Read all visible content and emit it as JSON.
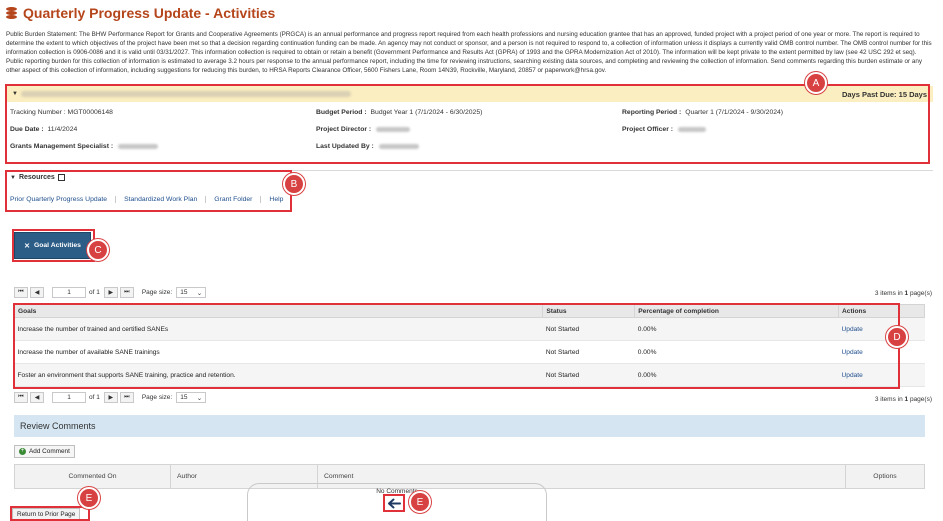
{
  "page": {
    "title": "Quarterly Progress Update - Activities",
    "burden_statement": "Public Burden Statement: The BHW Performance Report for Grants and Cooperative Agreements (PRGCA) is an annual performance and progress report required from each health professions and nursing education grantee that has an approved, funded project with a project period of one year or more. The report is required to determine the extent to which objectives of the project have been met so that a decision regarding continuation funding can be made. An agency may not conduct or sponsor, and a person is not required to respond to, a collection of information unless it displays a currently valid OMB control number. The OMB control number for this information collection is 0906-0086 and it is valid until 03/31/2027. This information collection is required to obtain or retain a benefit (Government Performance and Results Act (GPRA) of 1993 and the GPRA Modernization Act of 2010). The information will be kept private to the extent permitted by law (see 42 USC 292 et seq). Public reporting burden for this collection of information is estimated to average 3.2 hours per response to the annual performance report, including the time for reviewing instructions, searching existing data sources, and completing and reviewing the collection of information. Send comments regarding this burden estimate or any other aspect of this collection of information, including suggestions for reducing this burden, to HRSA Reports Clearance Officer, 5600 Fishers Lane, Room 14N39, Rockville, Maryland, 20857 or paperwork@hrsa.gov."
  },
  "info": {
    "days_past_due": "Days Past Due: 15 Days",
    "tracking_label": "Tracking Number :",
    "tracking_value": "MGT00006148",
    "budget_label": "Budget Period :",
    "budget_value": "Budget Year 1 (7/1/2024 - 6/30/2025)",
    "reporting_label": "Reporting Period :",
    "reporting_value": "Quarter 1 (7/1/2024 - 9/30/2024)",
    "due_label": "Due Date :",
    "due_value": "11/4/2024",
    "director_label": "Project Director :",
    "officer_label": "Project Officer :",
    "gms_label": "Grants Management Specialist :",
    "updated_label": "Last Updated By :"
  },
  "resources": {
    "title": "Resources",
    "links": [
      "Prior Quarterly Progress Update",
      "Standardized Work Plan",
      "Grant Folder",
      "Help"
    ]
  },
  "goal_button": "Goal Activities",
  "pager": {
    "page": "1",
    "of": "of 1",
    "page_size_label": "Page size:",
    "page_size": "15",
    "count_prefix": "3 items in ",
    "count_pages": "1",
    "count_suffix": " page(s)"
  },
  "goals_table": {
    "headers": [
      "Goals",
      "Status",
      "Percentage of completion",
      "Actions"
    ],
    "rows": [
      {
        "goal": "Increase the number of trained and certified SANEs",
        "status": "Not Started",
        "pct": "0.00%",
        "action": "Update"
      },
      {
        "goal": "Increase the number of available SANE trainings",
        "status": "Not Started",
        "pct": "0.00%",
        "action": "Update"
      },
      {
        "goal": "Foster an environment that supports SANE training, practice and retention.",
        "status": "Not Started",
        "pct": "0.00%",
        "action": "Update"
      }
    ]
  },
  "review": {
    "title": "Review Comments",
    "add_label": "Add Comment",
    "headers": [
      "Commented On",
      "Author",
      "Comment",
      "Options"
    ],
    "empty": "No Comments"
  },
  "return_label": "Return to Prior Page",
  "callouts": {
    "a": "A",
    "b": "B",
    "c": "C",
    "d": "D",
    "e1": "E",
    "e2": "E"
  },
  "colors": {
    "title": "#b5451b",
    "callout": "#e0303a",
    "button": "#2c5d87",
    "header_band": "#fbeec0"
  }
}
